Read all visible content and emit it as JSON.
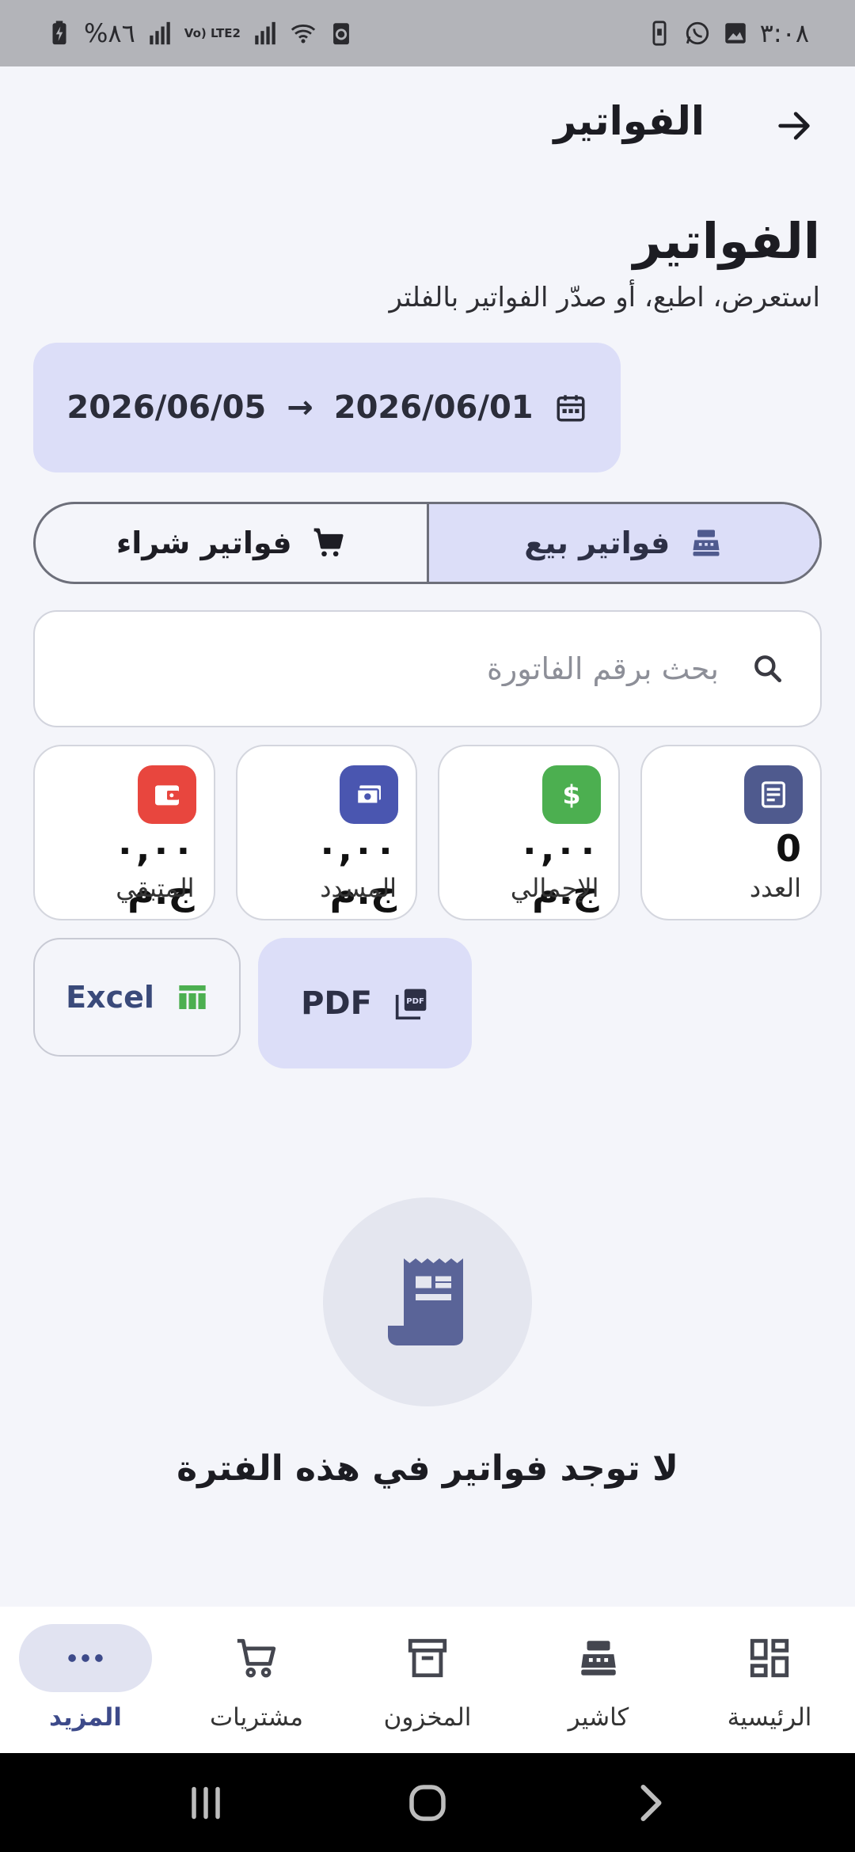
{
  "status_bar": {
    "time": "٣:٠٨",
    "battery_percent": "%٨٦",
    "network": "Vo) LTE2"
  },
  "app_bar": {
    "title": "الفواتير"
  },
  "header": {
    "title": "الفواتير",
    "subtitle": "استعرض، اطبع، أو صدّر الفواتير بالفلتر"
  },
  "date_range": {
    "start": "2026/06/01",
    "end": "2026/06/05",
    "separator": "→"
  },
  "tabs": [
    {
      "label": "فواتير بيع",
      "icon": "cash-register-icon",
      "active": true
    },
    {
      "label": "فواتير شراء",
      "icon": "cart-icon",
      "active": false
    }
  ],
  "search": {
    "placeholder": "بحث برقم الفاتورة",
    "value": ""
  },
  "stats": [
    {
      "label": "العدد",
      "value": "0",
      "icon": "document-icon",
      "color": "#4f5a8e"
    },
    {
      "label": "الإجمالي",
      "value": "٠,٠٠ ج.م",
      "icon": "dollar-icon",
      "color": "#4caf50"
    },
    {
      "label": "المسدد",
      "value": "٠,٠٠ ج.م",
      "icon": "payments-icon",
      "color": "#4a56b0"
    },
    {
      "label": "المتبقي",
      "value": "٠,٠٠ ج.م",
      "icon": "wallet-icon",
      "color": "#e8463e"
    }
  ],
  "export": {
    "pdf_label": "PDF",
    "excel_label": "Excel"
  },
  "empty_state": {
    "message": "لا توجد فواتير في هذه الفترة"
  },
  "bottom_nav": [
    {
      "label": "الرئيسية",
      "icon": "dashboard-icon",
      "active": false
    },
    {
      "label": "كاشير",
      "icon": "cash-register-icon",
      "active": false
    },
    {
      "label": "المخزون",
      "icon": "inventory-icon",
      "active": false
    },
    {
      "label": "مشتريات",
      "icon": "cart-icon",
      "active": false
    },
    {
      "label": "المزيد",
      "icon": "more-icon",
      "active": true
    }
  ],
  "colors": {
    "accent": "#3d4a8a",
    "tab_active_bg": "#dcdef8",
    "background": "#f4f5fa"
  }
}
